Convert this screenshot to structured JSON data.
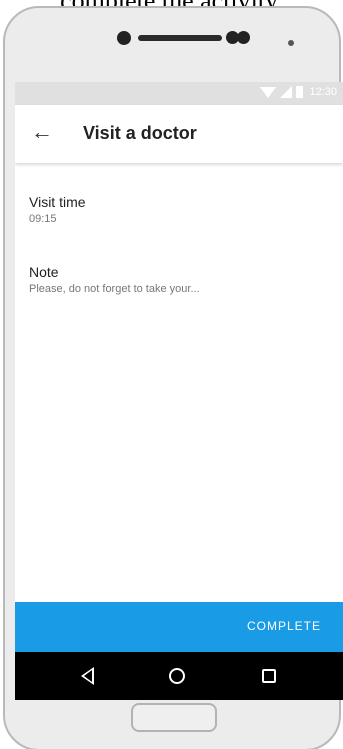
{
  "caption": "complete the activity.",
  "status_bar": {
    "time": "12:30"
  },
  "header": {
    "title": "Visit a doctor",
    "back_icon": "arrow-left-icon"
  },
  "fields": [
    {
      "label": "Visit time",
      "value": "09:15"
    },
    {
      "label": "Note",
      "value": "Please, do not forget to take your..."
    }
  ],
  "footer": {
    "complete_label": "COMPLETE",
    "accent_color": "#1a9be6"
  },
  "navigation": {
    "back": "triangle-back-icon",
    "home": "circle-home-icon",
    "recents": "square-recents-icon"
  }
}
